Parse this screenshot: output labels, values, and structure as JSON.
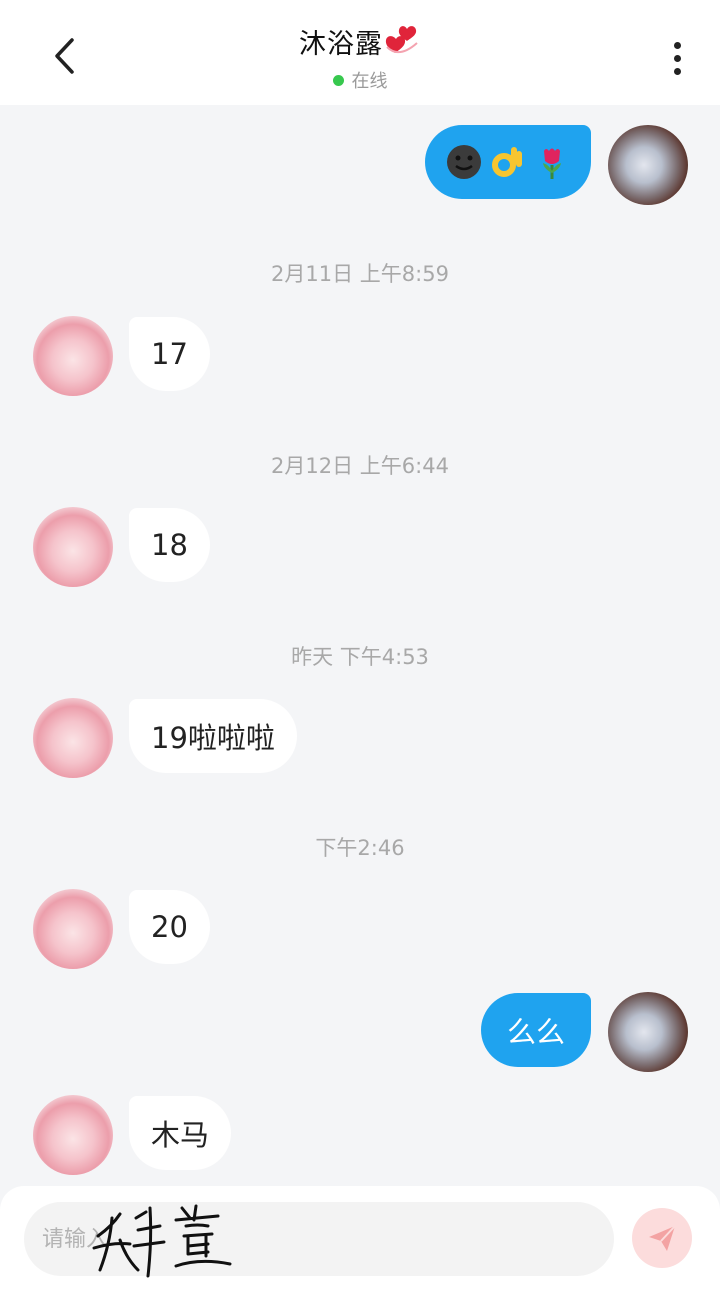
{
  "header": {
    "title": "沐浴露",
    "status": "在线",
    "colors": {
      "online": "#37c84e",
      "accent": "#1fa3ef"
    },
    "icons": {
      "back": "back-chevron-icon",
      "title_emoji": "two-hearts-icon",
      "more": "more-vertical-icon"
    }
  },
  "messages": [
    {
      "side": "out",
      "emojis": [
        "new-moon-face-icon",
        "ok-hand-icon",
        "tulip-icon"
      ]
    },
    {
      "time": "2月11日 上午8:59"
    },
    {
      "side": "in",
      "text": "17"
    },
    {
      "time": "2月12日 上午6:44"
    },
    {
      "side": "in",
      "text": "18"
    },
    {
      "time": "昨天 下午4:53"
    },
    {
      "side": "in",
      "text": "19啦啦啦"
    },
    {
      "time": "下午2:46"
    },
    {
      "side": "in",
      "text": "20"
    },
    {
      "side": "out",
      "text": "么么"
    },
    {
      "side": "in",
      "text": "木马"
    }
  ],
  "composer": {
    "placeholder": "请输入",
    "handwritten_overlay": "姅萱",
    "icons": {
      "send": "send-paper-plane-icon"
    },
    "colors": {
      "send_bg": "#fcdcdc",
      "send_icon": "#f3a3a3"
    }
  }
}
